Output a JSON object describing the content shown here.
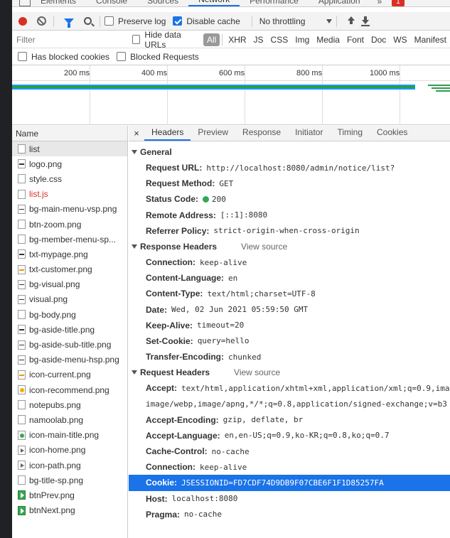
{
  "panel_tabs": [
    "Elements",
    "Console",
    "Sources",
    "Network",
    "Performance",
    "Application"
  ],
  "panel_more": "»",
  "error_badge": "1",
  "toolbar": {
    "preserve_log": "Preserve log",
    "disable_cache": "Disable cache",
    "throttling": "No throttling"
  },
  "filter": {
    "placeholder": "Filter",
    "hide_data_urls": "Hide data URLs",
    "types": [
      "All",
      "XHR",
      "JS",
      "CSS",
      "Img",
      "Media",
      "Font",
      "Doc",
      "WS",
      "Manifest"
    ],
    "has_blocked_cookies": "Has blocked cookies",
    "blocked_requests": "Blocked Requests"
  },
  "timeline": {
    "ticks": [
      "200 ms",
      "400 ms",
      "600 ms",
      "800 ms",
      "1000 ms"
    ]
  },
  "name_column": {
    "header": "Name",
    "rows": [
      {
        "name": "list",
        "icon": "doc"
      },
      {
        "name": "logo.png",
        "icon": "img"
      },
      {
        "name": "style.css",
        "icon": "doc"
      },
      {
        "name": "list.js",
        "icon": "doc"
      },
      {
        "name": "bg-main-menu-vsp.png",
        "icon": "img"
      },
      {
        "name": "btn-zoom.png",
        "icon": "doc"
      },
      {
        "name": "bg-member-menu-sp...",
        "icon": "doc"
      },
      {
        "name": "txt-mypage.png",
        "icon": "img"
      },
      {
        "name": "txt-customer.png",
        "icon": "orange"
      },
      {
        "name": "bg-visual.png",
        "icon": "img"
      },
      {
        "name": "visual.png",
        "icon": "img"
      },
      {
        "name": "bg-body.png",
        "icon": "doc"
      },
      {
        "name": "bg-aside-title.png",
        "icon": "img"
      },
      {
        "name": "bg-aside-sub-title.png",
        "icon": "img"
      },
      {
        "name": "bg-aside-menu-hsp.png",
        "icon": "img"
      },
      {
        "name": "icon-current.png",
        "icon": "orange"
      },
      {
        "name": "icon-recommend.png",
        "icon": "dot"
      },
      {
        "name": "notepubs.png",
        "icon": "doc"
      },
      {
        "name": "namoolab.png",
        "icon": "doc"
      },
      {
        "name": "icon-main-title.png",
        "icon": "green"
      },
      {
        "name": "icon-home.png",
        "icon": "flag"
      },
      {
        "name": "icon-path.png",
        "icon": "flag"
      },
      {
        "name": "bg-title-sp.png",
        "icon": "doc"
      },
      {
        "name": "btnPrev.png",
        "icon": "play"
      },
      {
        "name": "btnNext.png",
        "icon": "play"
      }
    ]
  },
  "details": {
    "close": "×",
    "tabs": [
      "Headers",
      "Preview",
      "Response",
      "Initiator",
      "Timing",
      "Cookies"
    ],
    "general": {
      "title": "General",
      "items": [
        {
          "k": "Request URL:",
          "v": "http://localhost:8080/admin/notice/list?"
        },
        {
          "k": "Request Method:",
          "v": "GET"
        },
        {
          "k": "Status Code:",
          "v": "200"
        },
        {
          "k": "Remote Address:",
          "v": "[::1]:8080"
        },
        {
          "k": "Referrer Policy:",
          "v": "strict-origin-when-cross-origin"
        }
      ]
    },
    "response_headers": {
      "title": "Response Headers",
      "view_source": "View source",
      "items": [
        {
          "k": "Connection:",
          "v": "keep-alive"
        },
        {
          "k": "Content-Language:",
          "v": "en"
        },
        {
          "k": "Content-Type:",
          "v": "text/html;charset=UTF-8"
        },
        {
          "k": "Date:",
          "v": "Wed, 02 Jun 2021 05:59:50 GMT"
        },
        {
          "k": "Keep-Alive:",
          "v": "timeout=20"
        },
        {
          "k": "Set-Cookie:",
          "v": "query=hello"
        },
        {
          "k": "Transfer-Encoding:",
          "v": "chunked"
        }
      ]
    },
    "request_headers": {
      "title": "Request Headers",
      "view_source": "View source",
      "items": [
        {
          "k": "Accept:",
          "v": "text/html,application/xhtml+xml,application/xml;q=0.9,ima"
        },
        {
          "k": "",
          "v": "image/webp,image/apng,*/*;q=0.8,application/signed-exchange;v=b3"
        },
        {
          "k": "Accept-Encoding:",
          "v": "gzip, deflate, br"
        },
        {
          "k": "Accept-Language:",
          "v": "en,en-US;q=0.9,ko-KR;q=0.8,ko;q=0.7"
        },
        {
          "k": "Cache-Control:",
          "v": "no-cache"
        },
        {
          "k": "Connection:",
          "v": "keep-alive"
        },
        {
          "k": "Cookie:",
          "v": "JSESSIONID=FD7CDF74D9DB9F07CBE6F1F1D85257FA"
        },
        {
          "k": "Host:",
          "v": "localhost:8080"
        },
        {
          "k": "Pragma:",
          "v": "no-cache"
        }
      ]
    }
  },
  "colors": {
    "accent": "#1a73e8",
    "record": "#d93025",
    "status_ok": "#34a853"
  }
}
